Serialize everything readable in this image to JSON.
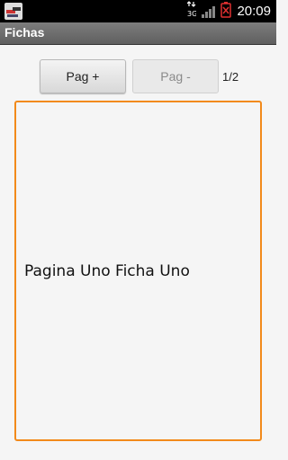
{
  "status_bar": {
    "time": "20:09",
    "network_label": "3G",
    "icons": [
      "app-notification-icon",
      "data-transfer-icon",
      "signal-icon",
      "battery-low-icon"
    ]
  },
  "app": {
    "title": "Fichas"
  },
  "controls": {
    "next_label": "Pag +",
    "prev_label": "Pag -",
    "page_indicator": "1/2"
  },
  "card": {
    "text": "Pagina Uno Ficha Uno"
  },
  "colors": {
    "card_border": "#f28a1b",
    "battery_alert": "#e03030",
    "background": "#f5f5f5"
  }
}
